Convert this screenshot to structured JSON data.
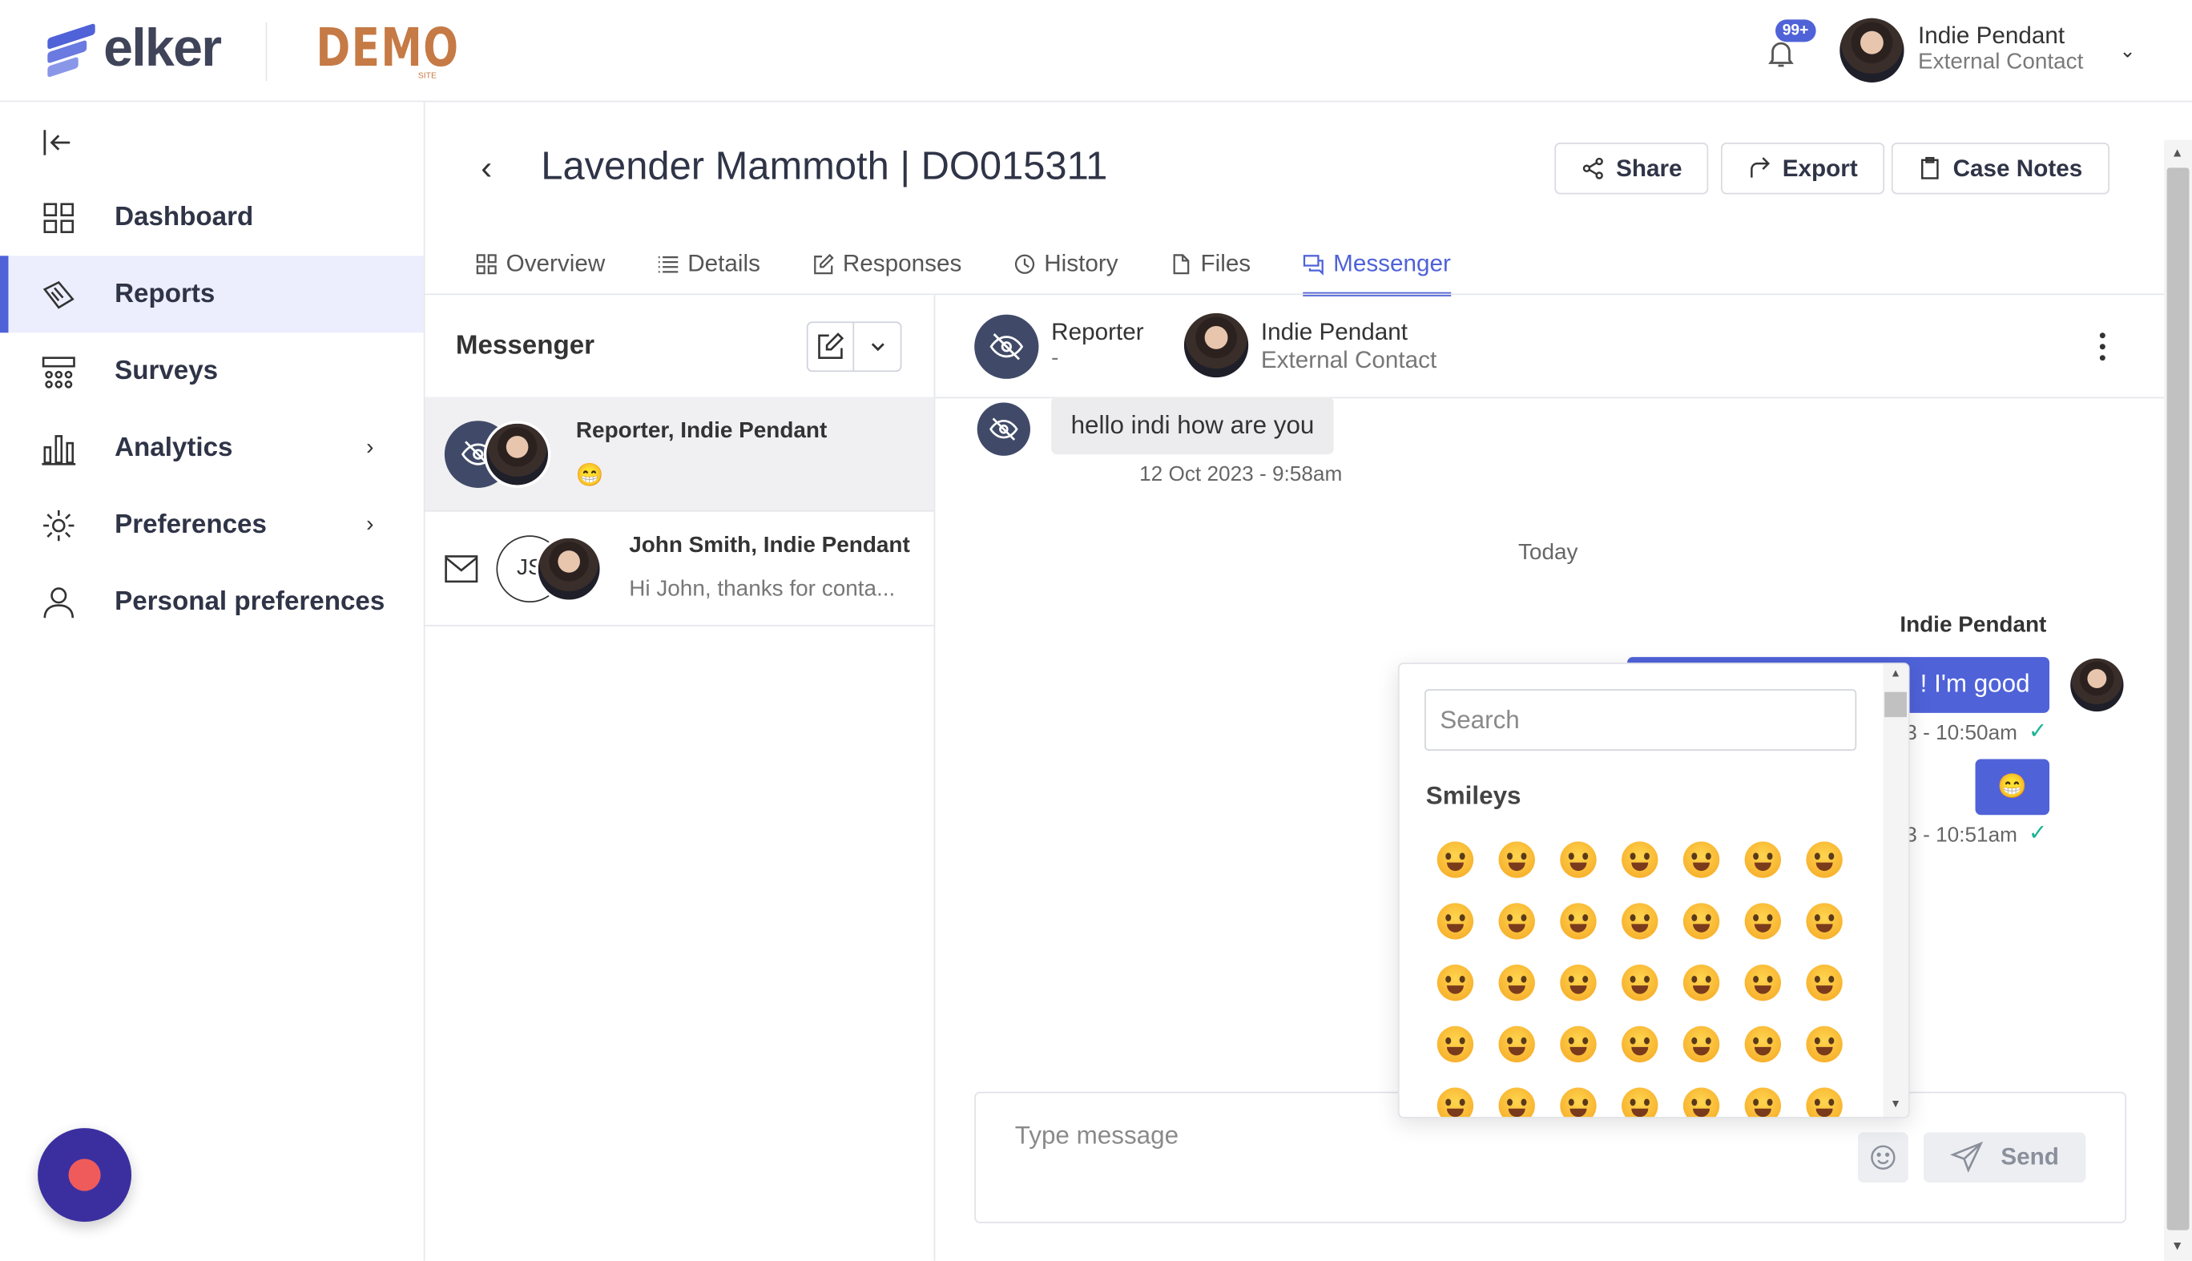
{
  "brand": {
    "logo_text": "elker",
    "demo_text": "DEMO",
    "demo_sub": "SITE"
  },
  "header": {
    "notifications_badge": "99+",
    "user_name": "Indie Pendant",
    "user_role": "External Contact"
  },
  "sidebar": {
    "items": [
      {
        "label": "Dashboard",
        "icon": "grid-icon"
      },
      {
        "label": "Reports",
        "icon": "reports-icon",
        "active": true
      },
      {
        "label": "Surveys",
        "icon": "survey-icon"
      },
      {
        "label": "Analytics",
        "icon": "chart-icon",
        "has_submenu": true
      },
      {
        "label": "Preferences",
        "icon": "gear-icon",
        "has_submenu": true
      },
      {
        "label": "Personal preferences",
        "icon": "user-icon"
      }
    ]
  },
  "page": {
    "title": "Lavender Mammoth | DO015311",
    "actions": {
      "share": "Share",
      "export": "Export",
      "case_notes": "Case Notes"
    },
    "tabs": [
      "Overview",
      "Details",
      "Responses",
      "History",
      "Files",
      "Messenger"
    ],
    "active_tab": "Messenger"
  },
  "messenger": {
    "panel_title": "Messenger",
    "conversations": [
      {
        "title": "Reporter, Indie Pendant",
        "preview": "😁",
        "active": true
      },
      {
        "title": "John Smith, Indie Pendant",
        "preview": "Hi John, thanks for conta...",
        "initials": "JS"
      }
    ]
  },
  "chat": {
    "participants": [
      {
        "name": "Reporter",
        "role": "-"
      },
      {
        "name": "Indie Pendant",
        "role": "External Contact"
      }
    ],
    "messages": [
      {
        "text": "hello indi how are you",
        "time": "12 Oct 2023 - 9:58am"
      }
    ],
    "day_divider": "Today",
    "outgoing_sender": "Indie Pendant",
    "outgoing": [
      {
        "text": "! I'm good",
        "time": "3 - 10:50am"
      },
      {
        "text": "😁",
        "time": "3 - 10:51am"
      }
    ],
    "input_placeholder": "Type message",
    "send_label": "Send"
  },
  "emoji_picker": {
    "search_placeholder": "Search",
    "category": "Smileys",
    "emojis": [
      "😀",
      "😃",
      "😄",
      "😁",
      "😆",
      "😅",
      "🤣",
      "😂",
      "🙂",
      "🙃",
      "😉",
      "😊",
      "😇",
      "🥰",
      "😍",
      "🤩",
      "😘",
      "😗",
      "☺️",
      "😚",
      "😙",
      "😋",
      "😛",
      "😜",
      "🤪",
      "😝",
      "🤑",
      "🤗",
      "🤭",
      "🤫",
      "🤔",
      "🤐",
      "🤨",
      "😐",
      "😑"
    ]
  },
  "colors": {
    "accent": "#4f62d8",
    "active_nav_bg": "#eceefe",
    "check": "#1bb394",
    "demo": "#c67a45",
    "fab": "#3b2fa0"
  }
}
